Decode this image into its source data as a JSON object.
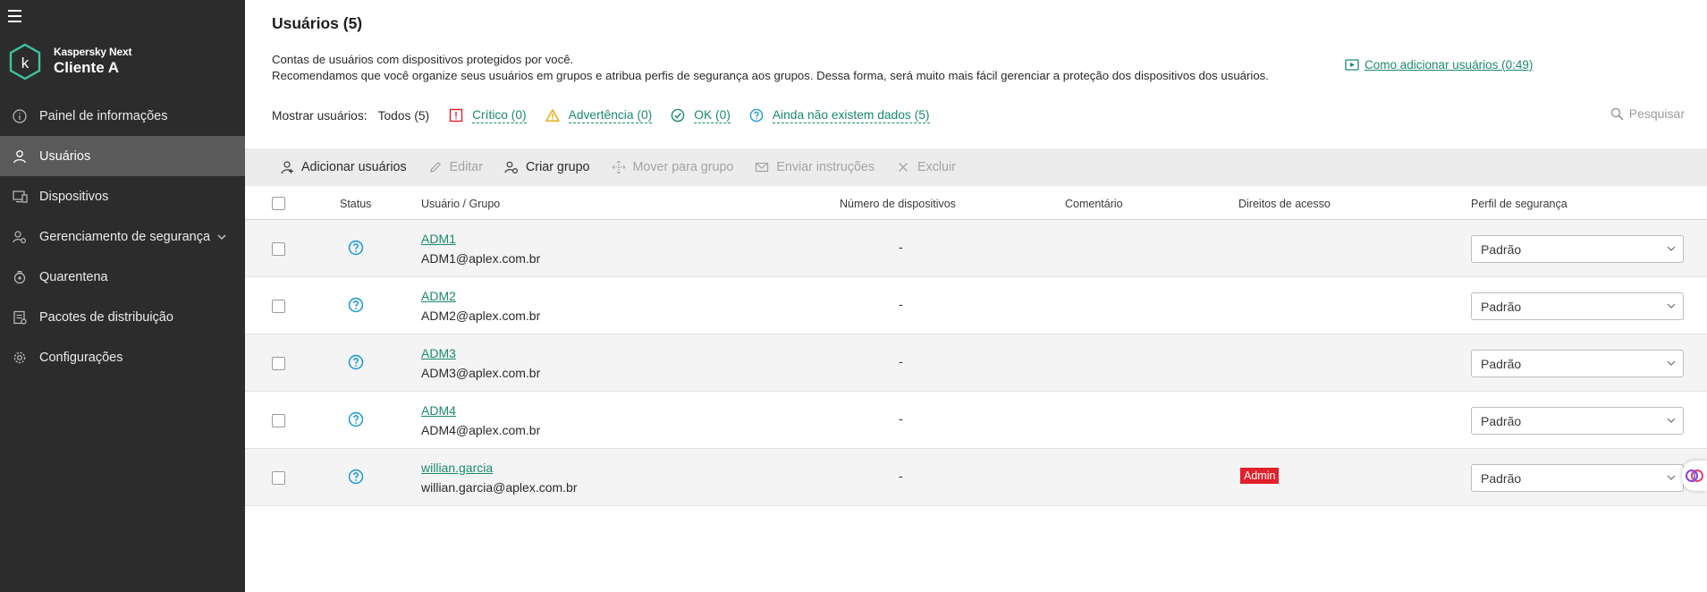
{
  "sidebar": {
    "brand_product": "Kaspersky Next",
    "brand_client": "Cliente A",
    "items": [
      {
        "label": "Painel de informações",
        "icon": "info-icon"
      },
      {
        "label": "Usuários",
        "icon": "user-icon"
      },
      {
        "label": "Dispositivos",
        "icon": "devices-icon"
      },
      {
        "label": "Gerenciamento de segurança",
        "icon": "security-management-icon"
      },
      {
        "label": "Quarentena",
        "icon": "quarantine-icon"
      },
      {
        "label": "Pacotes de distribuição",
        "icon": "packages-icon"
      },
      {
        "label": "Configurações",
        "icon": "gear-icon"
      }
    ]
  },
  "header": {
    "title": "Usuários (5)",
    "desc_line1": "Contas de usuários com dispositivos protegidos por você.",
    "desc_line2": "Recomendamos que você organize seus usuários em grupos e atribua perfis de segurança aos grupos. Dessa forma, será muito mais fácil gerenciar a proteção dos dispositivos dos usuários.",
    "howto_link": "Como adicionar usuários (0:49)"
  },
  "filters": {
    "label": "Mostrar usuários:",
    "all": "Todos (5)",
    "critical": "Crítico (0)",
    "warning": "Advertência (0)",
    "ok": "OK (0)",
    "nodata": "Ainda não existem dados (5)"
  },
  "search": {
    "placeholder": "Pesquisar"
  },
  "toolbar": {
    "add": "Adicionar usuários",
    "edit": "Editar",
    "create_group": "Criar grupo",
    "move": "Mover para grupo",
    "send": "Enviar instruções",
    "delete": "Excluir"
  },
  "table": {
    "headers": {
      "status": "Status",
      "user": "Usuário / Grupo",
      "devices": "Número de dispositivos",
      "comment": "Comentário",
      "access": "Direitos de acesso",
      "profile": "Perfil de segurança"
    },
    "rows": [
      {
        "name": "ADM1",
        "email": "ADM1@aplex.com.br",
        "devices": "-",
        "access": "",
        "profile": "Padrão"
      },
      {
        "name": "ADM2",
        "email": "ADM2@aplex.com.br",
        "devices": "-",
        "access": "",
        "profile": "Padrão"
      },
      {
        "name": "ADM3",
        "email": "ADM3@aplex.com.br",
        "devices": "-",
        "access": "",
        "profile": "Padrão"
      },
      {
        "name": "ADM4",
        "email": "ADM4@aplex.com.br",
        "devices": "-",
        "access": "",
        "profile": "Padrão"
      },
      {
        "name": "willian.garcia",
        "email": "willian.garcia@aplex.com.br",
        "devices": "-",
        "access": "Admin",
        "profile": "Padrão"
      }
    ]
  },
  "colors": {
    "sidebar_bg": "#2c2c2c",
    "accent_green": "#1a8a6f",
    "critical_red": "#e0202a",
    "warning_yellow": "#e8a800",
    "status_blue": "#1e9bd7"
  }
}
